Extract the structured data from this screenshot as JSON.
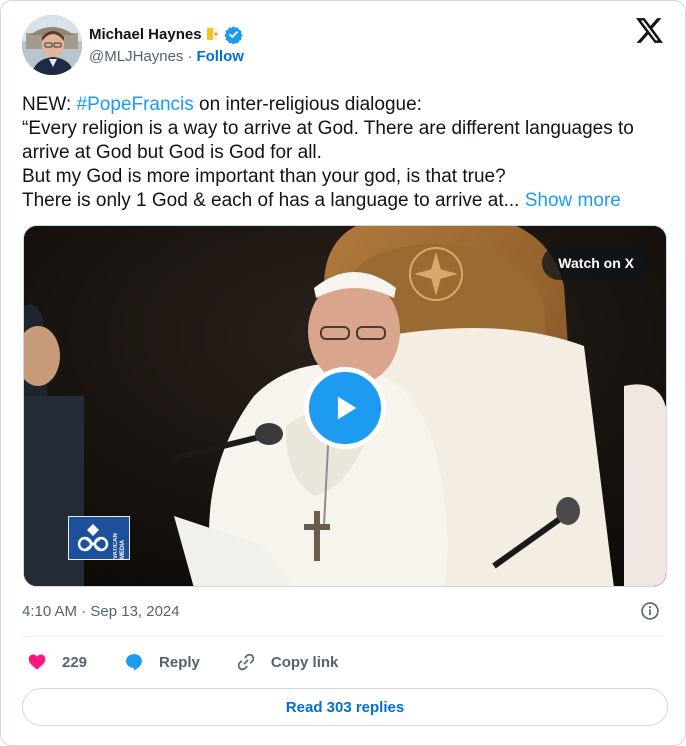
{
  "author": {
    "name": "Michael Haynes",
    "handle": "@MLJHaynes",
    "separator": "·",
    "follow_label": "Follow"
  },
  "tweet": {
    "prefix": "NEW: ",
    "hashtag": "#PopeFrancis",
    "line1_rest": " on inter-religious dialogue:",
    "body": "“Every religion is a way to arrive at God. There are different languages to arrive at God but God is God for all.\nBut my God is more important than your god, is that true?\nThere is only 1 God & each of has a language to arrive at... ",
    "show_more_label": "Show more"
  },
  "media": {
    "watch_label": "Watch on X",
    "logo_text_line1": "VATICAN",
    "logo_text_line2": "MEDIA"
  },
  "meta": {
    "timestamp": "4:10 AM · Sep 13, 2024"
  },
  "actions": {
    "like_count": "229",
    "reply_label": "Reply",
    "copy_link_label": "Copy link"
  },
  "read_replies_label": "Read 303 replies",
  "colors": {
    "accent": "#1d9bf0",
    "link_blue": "#006fd6",
    "like_red": "#f91880",
    "muted": "#536471"
  },
  "icons": [
    "flag-icon",
    "verified-badge-icon",
    "x-logo-icon",
    "play-icon",
    "info-icon",
    "heart-icon",
    "reply-bubble-icon",
    "link-icon"
  ]
}
